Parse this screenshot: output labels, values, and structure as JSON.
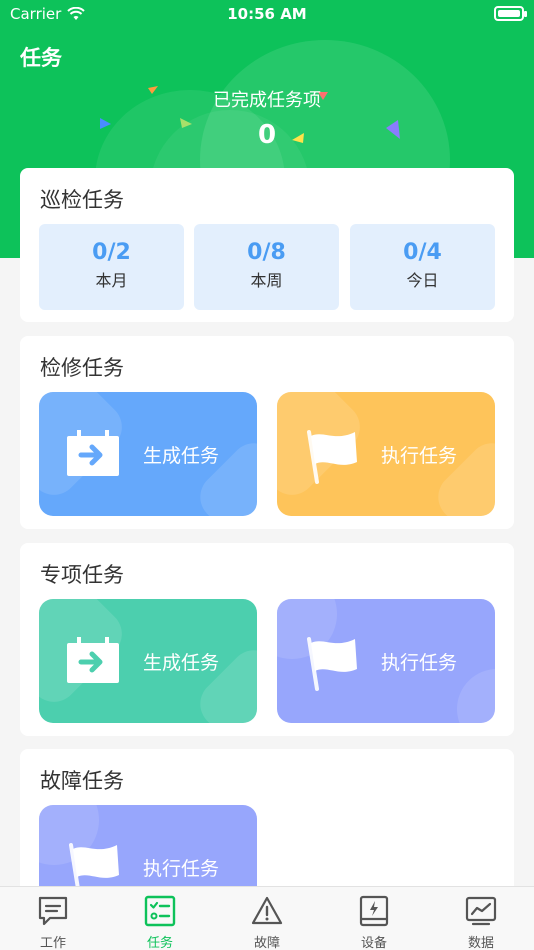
{
  "status_bar": {
    "carrier": "Carrier",
    "time": "10:56 AM"
  },
  "header": {
    "title": "任务",
    "completed_label": "已完成任务项",
    "completed_count": "0"
  },
  "inspection": {
    "title": "巡检任务",
    "stats": [
      {
        "value": "0/2",
        "label": "本月"
      },
      {
        "value": "0/8",
        "label": "本周"
      },
      {
        "value": "0/4",
        "label": "今日"
      }
    ]
  },
  "maintenance": {
    "title": "检修任务",
    "generate_label": "生成任务",
    "execute_label": "执行任务"
  },
  "special": {
    "title": "专项任务",
    "generate_label": "生成任务",
    "execute_label": "执行任务"
  },
  "fault": {
    "title": "故障任务",
    "execute_label": "执行任务"
  },
  "tabs": [
    {
      "label": "工作",
      "icon": "message-icon"
    },
    {
      "label": "任务",
      "icon": "task-list-icon"
    },
    {
      "label": "故障",
      "icon": "warning-icon"
    },
    {
      "label": "设备",
      "icon": "device-icon"
    },
    {
      "label": "数据",
      "icon": "chart-icon"
    }
  ],
  "colors": {
    "brand_green": "#0dc25a",
    "stat_blue": "#4a9cf3",
    "tile_blue": "#65a8fb",
    "tile_orange": "#fec45a",
    "tile_teal": "#4ccfae",
    "tile_purple": "#97a6fc"
  }
}
